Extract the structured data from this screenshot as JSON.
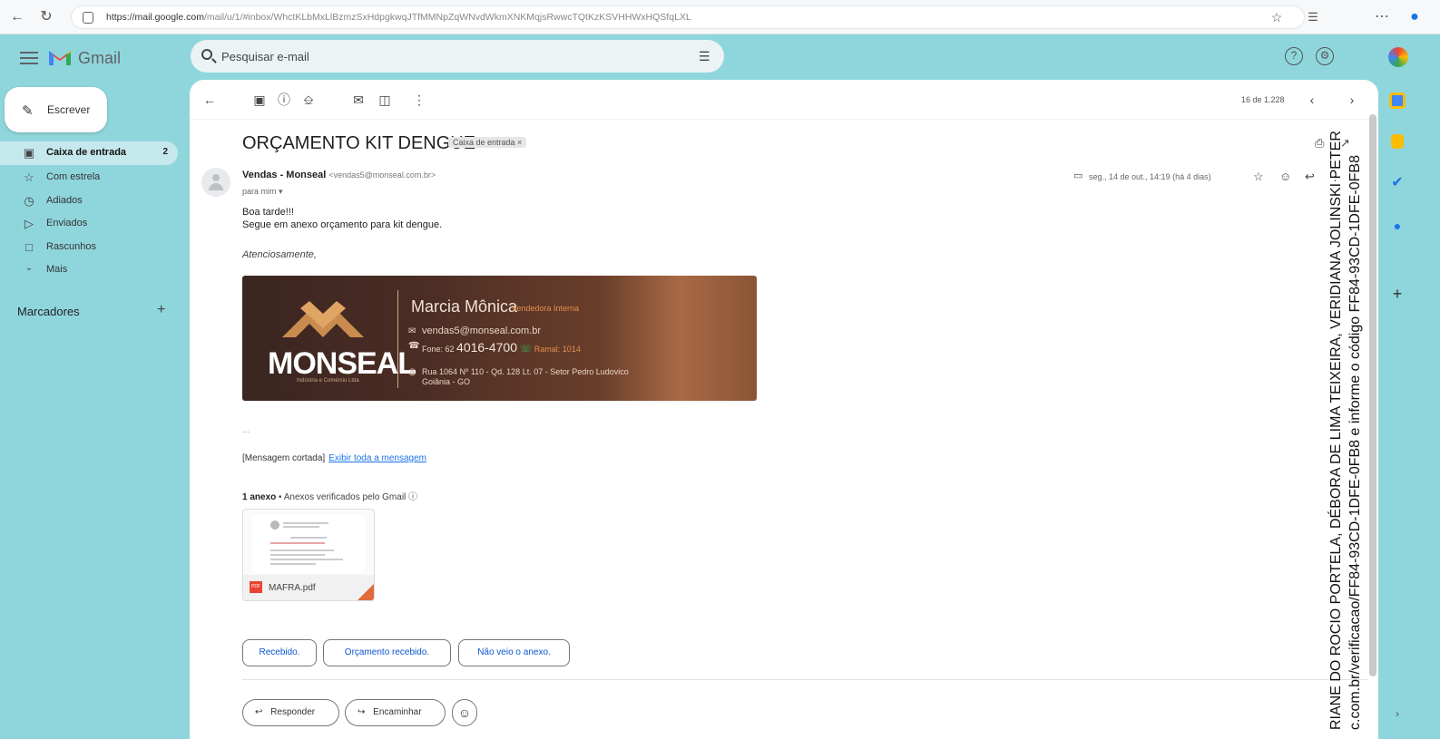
{
  "browser": {
    "url_domain": "https://mail.google.com",
    "url_path": "/mail/u/1/#inbox/WhctKLbMxLlBzmzSxHdpgkwqJTfMMNpZqWNvdWkmXNKMqjsRwwcTQtKzKSVHHWxHQSfqLXL"
  },
  "app": {
    "name": "Gmail"
  },
  "search": {
    "placeholder": "Pesquisar e-mail"
  },
  "compose": {
    "label": "Escrever"
  },
  "sidebar": {
    "items": [
      {
        "label": "Caixa de entrada",
        "count": "2",
        "icon": "inbox-icon"
      },
      {
        "label": "Com estrela",
        "icon": "star-icon"
      },
      {
        "label": "Adiados",
        "icon": "clock-icon"
      },
      {
        "label": "Enviados",
        "icon": "send-icon"
      },
      {
        "label": "Rascunhos",
        "icon": "draft-icon"
      },
      {
        "label": "Mais",
        "icon": "chevron-down-icon"
      }
    ],
    "labels_title": "Marcadores"
  },
  "toolbar": {
    "counter": "16 de 1.228"
  },
  "email": {
    "subject": "ORÇAMENTO KIT DENGUE",
    "tag": "Caixa de entrada ×",
    "sender_name": "Vendas - Monseal",
    "sender_email": "<vendas5@monseal.com.br>",
    "to": "para mim",
    "date": "seg., 14 de out., 14:19 (há 4 dias)",
    "body_line1": "Boa tarde!!!",
    "body_line2": "Segue em anexo orçamento para kit dengue.",
    "closing": "Atenciosamente,",
    "ellipsis": "...",
    "cut_text": "[Mensagem cortada]",
    "cut_link": "Exibir toda a mensagem"
  },
  "banner": {
    "name": "Marcia Mônica",
    "role": "Vendedora Interna",
    "email": "vendas5@monseal.com.br",
    "phone_prefix": "Fone: 62",
    "phone": "4016-4700",
    "extension": "Ramal: 1014",
    "address1": "Rua 1064 Nº 110 - Qd. 128 Lt. 07 - Setor Pedro Ludovico",
    "address2": "Goiânia - GO",
    "logo": "MONSEAL",
    "logo_sub": "Indústria e Comércio Ltda"
  },
  "attachment": {
    "count_label": "1 anexo",
    "verified": "• Anexos verificados pelo Gmail",
    "file_name": "MAFRA.pdf",
    "type_badge": "PDF"
  },
  "smart_replies": [
    "Recebido.",
    "Orçamento recebido.",
    "Não veio o anexo."
  ],
  "actions": {
    "reply": "Responder",
    "forward": "Encaminhar"
  },
  "watermark": {
    "line1": "RIANE DO ROCIO PORTELA, DÉBORA DE LIMA TEIXEIRA, VERIDIANA JOLINSKI PETER",
    "line2": "c.com.br/verificacao/FF84-93CD-1DFE-0FB8 e informe o código FF84-93CD-1DFE-0FB8"
  }
}
